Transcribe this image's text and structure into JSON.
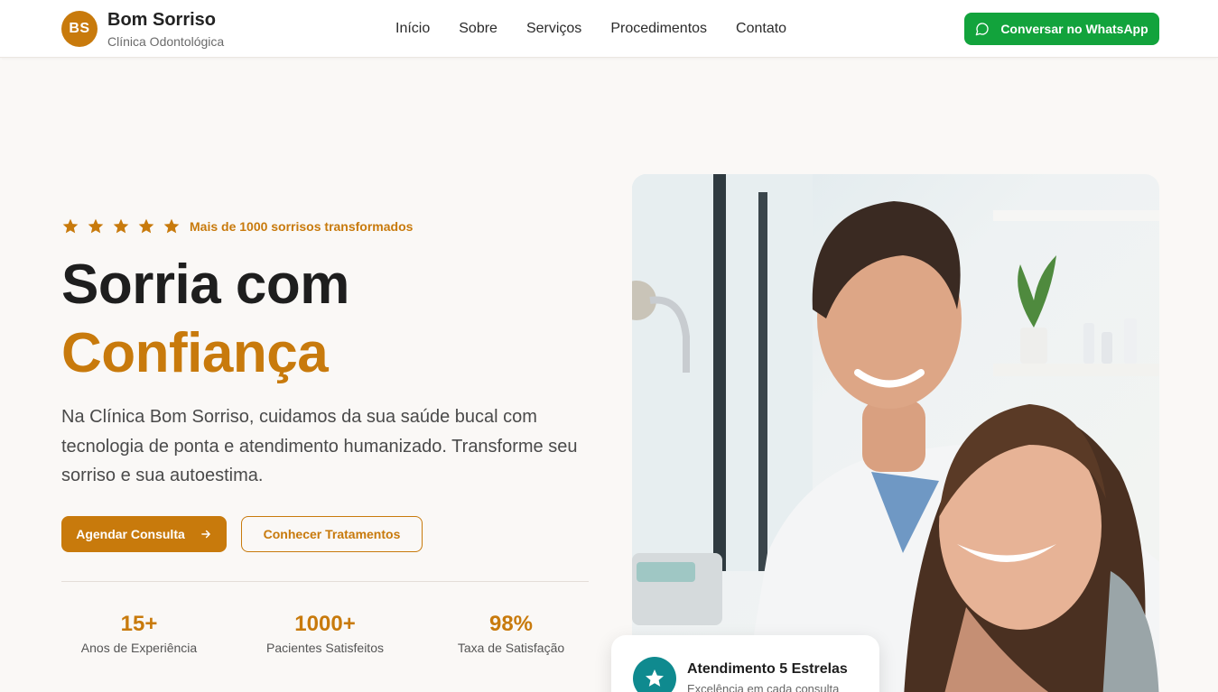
{
  "brand": {
    "initials": "BS",
    "name": "Bom Sorriso",
    "subtitle": "Clínica Odontológica"
  },
  "nav": {
    "items": [
      "Início",
      "Sobre",
      "Serviços",
      "Procedimentos",
      "Contato"
    ]
  },
  "cta_whatsapp": {
    "label": "Conversar no WhatsApp",
    "icon": "chat-bubble-icon"
  },
  "hero": {
    "rating_stars": 5,
    "rating_text": "Mais de 1000 sorrisos transformados",
    "title_line1": "Sorria com",
    "title_line2": "Confiança",
    "lead": "Na Clínica Bom Sorriso, cuidamos da sua saúde bucal com tecnologia de ponta e atendimento humanizado. Transforme seu sorriso e sua autoestima.",
    "primary_button": "Agendar Consulta",
    "secondary_button": "Conhecer Tratamentos",
    "stats": [
      {
        "value": "15+",
        "label": "Anos de Experiência"
      },
      {
        "value": "1000+",
        "label": "Pacientes Satisfeitos"
      },
      {
        "value": "98%",
        "label": "Taxa de Satisfação"
      }
    ]
  },
  "badge_card": {
    "title": "Atendimento 5 Estrelas",
    "subtitle": "Excelência em cada consulta"
  },
  "colors": {
    "accent": "#c87a0c",
    "whatsapp": "#12a33c",
    "teal": "#0f8a8f"
  }
}
